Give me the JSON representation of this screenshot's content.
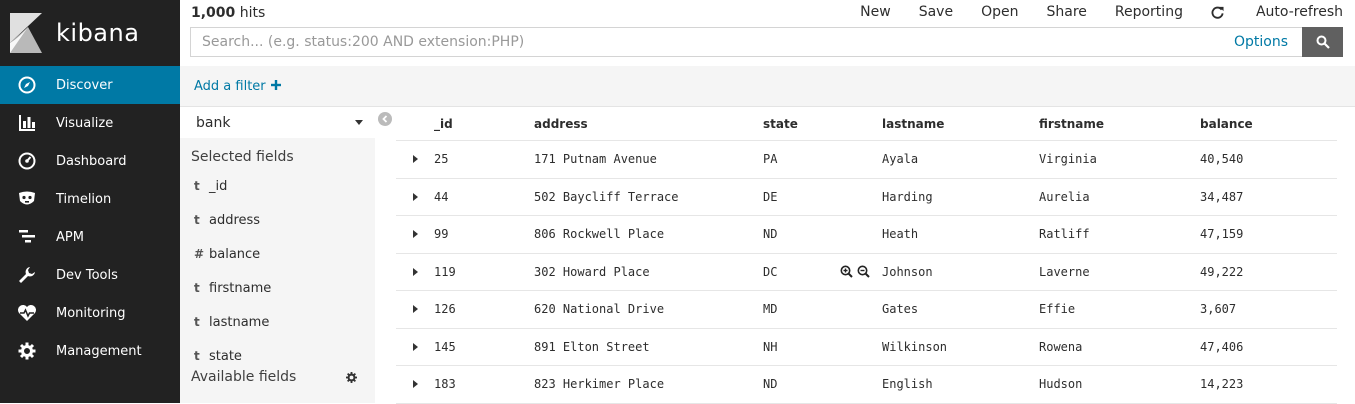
{
  "app": {
    "name": "kibana"
  },
  "sidebar": {
    "items": [
      {
        "label": "Discover",
        "icon": "compass-icon",
        "active": true
      },
      {
        "label": "Visualize",
        "icon": "bar-chart-icon"
      },
      {
        "label": "Dashboard",
        "icon": "dashboard-gauge-icon"
      },
      {
        "label": "Timelion",
        "icon": "timelion-mask-icon"
      },
      {
        "label": "APM",
        "icon": "apm-bars-icon"
      },
      {
        "label": "Dev Tools",
        "icon": "wrench-icon"
      },
      {
        "label": "Monitoring",
        "icon": "heartbeat-icon"
      },
      {
        "label": "Management",
        "icon": "gear-icon"
      }
    ]
  },
  "topbar": {
    "hits_count": "1,000",
    "hits_label": "hits",
    "menu": {
      "new": "New",
      "save": "Save",
      "open": "Open",
      "share": "Share",
      "reporting": "Reporting",
      "auto_refresh": "Auto-refresh"
    },
    "search_placeholder": "Search... (e.g. status:200 AND extension:PHP)",
    "options": "Options"
  },
  "filterbar": {
    "add_filter": "Add a filter"
  },
  "fields": {
    "index_pattern": "bank",
    "selected_title": "Selected fields",
    "selected": [
      {
        "type": "t",
        "name": "_id"
      },
      {
        "type": "t",
        "name": "address"
      },
      {
        "type": "#",
        "name": "balance"
      },
      {
        "type": "t",
        "name": "firstname"
      },
      {
        "type": "t",
        "name": "lastname"
      },
      {
        "type": "t",
        "name": "state"
      }
    ],
    "available_title": "Available fields"
  },
  "table": {
    "headers": [
      "_id",
      "address",
      "state",
      "lastname",
      "firstname",
      "balance"
    ],
    "rows": [
      [
        "25",
        "171 Putnam Avenue",
        "PA",
        "Ayala",
        "Virginia",
        "40,540"
      ],
      [
        "44",
        "502 Baycliff Terrace",
        "DE",
        "Harding",
        "Aurelia",
        "34,487"
      ],
      [
        "99",
        "806 Rockwell Place",
        "ND",
        "Heath",
        "Ratliff",
        "47,159"
      ],
      [
        "119",
        "302 Howard Place",
        "DC",
        "Johnson",
        "Laverne",
        "49,222"
      ],
      [
        "126",
        "620 National Drive",
        "MD",
        "Gates",
        "Effie",
        "3,607"
      ],
      [
        "145",
        "891 Elton Street",
        "NH",
        "Wilkinson",
        "Rowena",
        "47,406"
      ],
      [
        "183",
        "823 Herkimer Place",
        "ND",
        "English",
        "Hudson",
        "14,223"
      ]
    ]
  },
  "colors": {
    "sidebar_bg": "#222222",
    "accent": "#0079a5",
    "active_nav": "#0079a5",
    "panel_bg": "#f5f5f5"
  }
}
